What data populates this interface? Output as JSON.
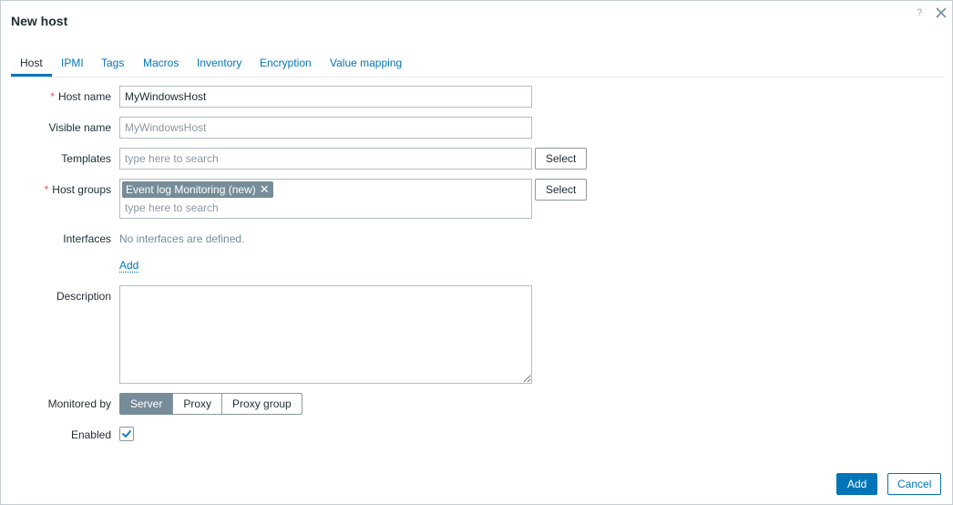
{
  "dialog": {
    "title": "New host",
    "help_label": "?",
    "close_icon": "close-icon"
  },
  "tabs": [
    {
      "label": "Host",
      "active": true
    },
    {
      "label": "IPMI"
    },
    {
      "label": "Tags"
    },
    {
      "label": "Macros"
    },
    {
      "label": "Inventory"
    },
    {
      "label": "Encryption"
    },
    {
      "label": "Value mapping"
    }
  ],
  "form": {
    "required_mark": "*",
    "host_name": {
      "label": "Host name",
      "value": "MyWindowsHost"
    },
    "visible_name": {
      "label": "Visible name",
      "placeholder": "MyWindowsHost"
    },
    "templates": {
      "label": "Templates",
      "placeholder": "type here to search",
      "select_label": "Select"
    },
    "host_groups": {
      "label": "Host groups",
      "chip": "Event log Monitoring (new)",
      "chip_remove": "✕",
      "placeholder": "type here to search",
      "select_label": "Select"
    },
    "interfaces": {
      "label": "Interfaces",
      "empty_text": "No interfaces are defined.",
      "add_link": "Add"
    },
    "description": {
      "label": "Description",
      "value": ""
    },
    "monitored_by": {
      "label": "Monitored by",
      "options": [
        "Server",
        "Proxy",
        "Proxy group"
      ],
      "selected": "Server"
    },
    "enabled": {
      "label": "Enabled",
      "checked": true
    }
  },
  "footer": {
    "add_label": "Add",
    "cancel_label": "Cancel"
  },
  "colors": {
    "accent": "#0275b8",
    "required": "#e45959",
    "selected_segment": "#768d99"
  }
}
